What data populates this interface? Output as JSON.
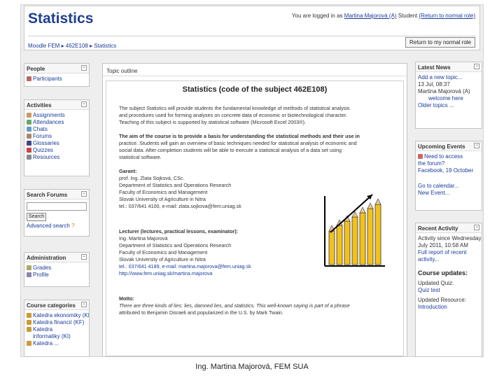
{
  "header": {
    "title": "Statistics",
    "login_text": "You are logged in as",
    "user": "Martina Majorová (A)",
    "role": "Student",
    "return_link": "(Return to normal role)",
    "breadcrumb": "Moodle FEM ▸ 462E108 ▸ Statistics",
    "return_button": "Return to my normal role"
  },
  "left": {
    "people": {
      "title": "People",
      "items": [
        "Participants"
      ]
    },
    "activities": {
      "title": "Activities",
      "items": [
        "Assignments",
        "Attendances",
        "Chats",
        "Forums",
        "Glossaries",
        "Quizzes",
        "Resources"
      ]
    },
    "search": {
      "title": "Search Forums",
      "button": "Search",
      "advanced": "Advanced search"
    },
    "admin": {
      "title": "Administration",
      "items": [
        "Grades",
        "Profile"
      ]
    },
    "categories": {
      "title": "Course categories",
      "items": [
        "Katedra ekonomiky (KE)",
        "Katedra financií (KF)",
        "Katedra",
        "informatiky (KI)",
        "Katedra ..."
      ]
    }
  },
  "center": {
    "outline": "Topic outline",
    "course_title": "Statistics (code of the subject 462E108)",
    "intro": [
      "The subject Statistics will provide students the fundamental knowledge of methods of statistical analysis",
      "and procedures used for forming analyses on concrete data of economic or biotechnological character.",
      "Teaching of this subject is supported by statistical software (Microsoft Excel 2003®)."
    ],
    "aim": [
      "The aim of the course is to provide a basis for understanding the statistical methods and their use in",
      "practice. Students will gain an overview of basic techniques needed for statistical analysis of economic and",
      "social data. After completion students will be able to execute a statistical analysis of a data set using",
      "statistical software."
    ],
    "garant": [
      "Garant:",
      "prof. Ing. Zlata Sojková, CSc.",
      "Department of Statistics and Operations Research",
      "Faculty of Economics and Management",
      "Slovak University of Agriculture in Nitra",
      "tel.: 037/641 4100, e-mail: zlata.sojkova@fem.uniag.sk"
    ],
    "lecturer": [
      "Lecturer (lectures, practical lessons, examinator):",
      "Ing. Martina Majorová",
      "Department of Statistics and Operations Research",
      "Faculty of Economics and Management",
      "Slovak University of Agriculture in Nitra",
      "tel.: 037/641 4189, e-mail: martina.majorova@fem.uniag.sk",
      "http://www.fem.uniag.sk/martina.majorova"
    ],
    "motto": [
      "Motto:",
      "There are three kinds of lies: lies, damned lies, and statistics. This well-known saying is part of a phrase",
      "attributed to Benjamin Disraeli and popularized in the U.S. by Mark Twain."
    ]
  },
  "right": {
    "news": {
      "title": "Latest News",
      "items": [
        "Add a new topic...",
        "13 Jul, 08:37",
        "Martina Majorová (A)",
        "welcome here",
        "Older topics ..."
      ]
    },
    "events": {
      "title": "Upcoming Events",
      "items": [
        "Need to access",
        "the forum?",
        "Facebook, 19 October",
        "Go to calendar...",
        "New Event..."
      ]
    },
    "activity": {
      "title": "Recent Activity",
      "items": [
        "Activity since Wednesday, 13",
        "July 2011, 10:58 AM",
        "Full report of recent",
        "activity..."
      ],
      "updates_title": "Course updates:",
      "updates": [
        "Updated Quiz:",
        "Quiz test",
        "Updated Resource:",
        "Introduction"
      ]
    }
  },
  "footer": {
    "caption": "Ing. Martina Majorová, FEM SUA"
  },
  "colors": {
    "link": "#1a3b9b",
    "title": "#1f3f8f",
    "pencil": "#f2c21b"
  }
}
